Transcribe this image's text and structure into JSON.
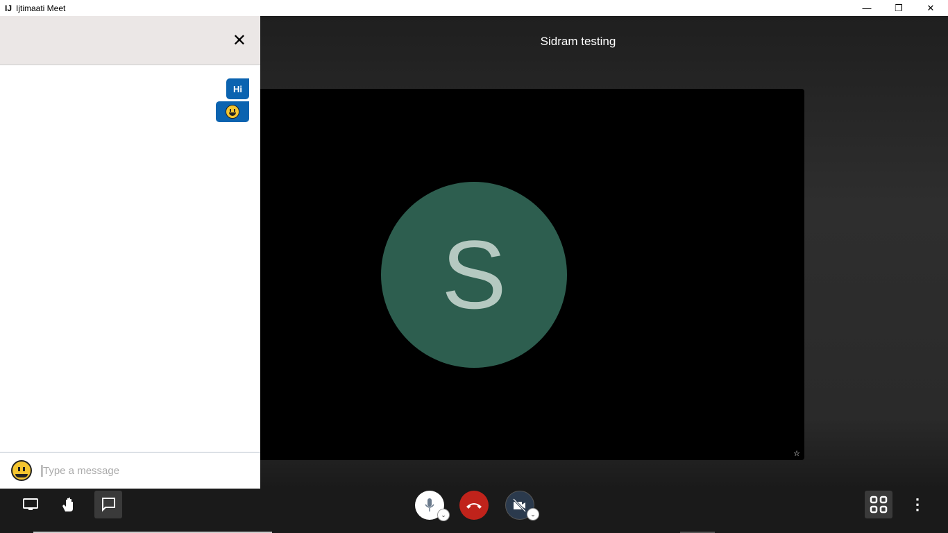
{
  "window": {
    "title": "Ijtimaati Meet",
    "logo": "IJ",
    "minimize": "—",
    "restore": "❐",
    "close": "✕"
  },
  "room": {
    "name": "Sidram testing"
  },
  "participant": {
    "initial": "S",
    "avatar_color": "#2d5e4f"
  },
  "chat": {
    "messages": [
      {
        "text": "Hi"
      },
      {
        "emoji": "grinning-face"
      }
    ],
    "placeholder": "Type a message",
    "close": "✕"
  },
  "toolbar": {
    "items": [
      "screen-share",
      "raise-hand",
      "chat",
      "microphone",
      "hangup",
      "camera-off",
      "tile-view",
      "more-options"
    ],
    "more": "⋮"
  }
}
